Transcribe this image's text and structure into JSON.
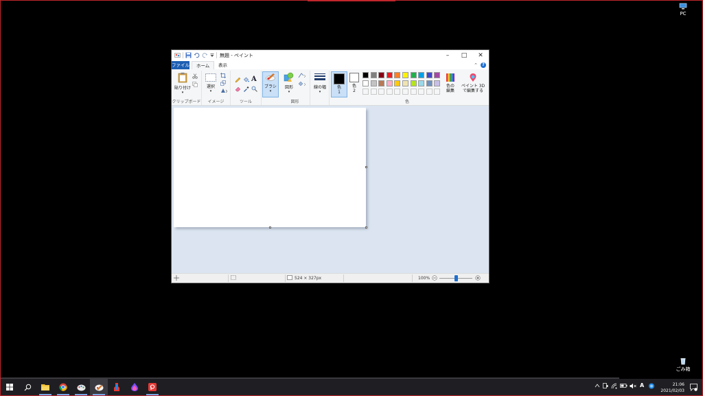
{
  "desktop": {
    "icons": [
      {
        "label": "PC"
      },
      {
        "label": "ごみ箱"
      }
    ]
  },
  "window": {
    "title": "無題 - ペイント",
    "tabs": [
      "ファイル",
      "ホーム",
      "表示"
    ],
    "groups": {
      "clipboard": "クリップボード",
      "image": "イメージ",
      "tools": "ツール",
      "shapes": "図形",
      "colors": "色"
    },
    "buttons": {
      "paste": "貼り付け",
      "select": "選択",
      "brush": "ブラシ",
      "shapes": "図形",
      "size": "線の幅",
      "color1": "色\n1",
      "color2": "色\n2",
      "edit_colors": "色の\n編集",
      "paint3d": "ペイント 3D\nで編集する"
    },
    "palette": [
      "#000000",
      "#7f7f7f",
      "#880015",
      "#ed1c24",
      "#ff7f27",
      "#fff200",
      "#22b14c",
      "#00a2e8",
      "#3f48cc",
      "#a349a4",
      "#ffffff",
      "#c3c3c3",
      "#b97a57",
      "#ffaec9",
      "#ffc90e",
      "#efe4b0",
      "#b5e61d",
      "#99d9ea",
      "#7092be",
      "#c8bfe7"
    ],
    "status": {
      "canvas_size": "524 × 327px",
      "zoom": "100%",
      "zoom_level": 0.5
    }
  },
  "taskbar": {
    "time": "21:06",
    "date": "2021/02/03",
    "ime": "A"
  }
}
